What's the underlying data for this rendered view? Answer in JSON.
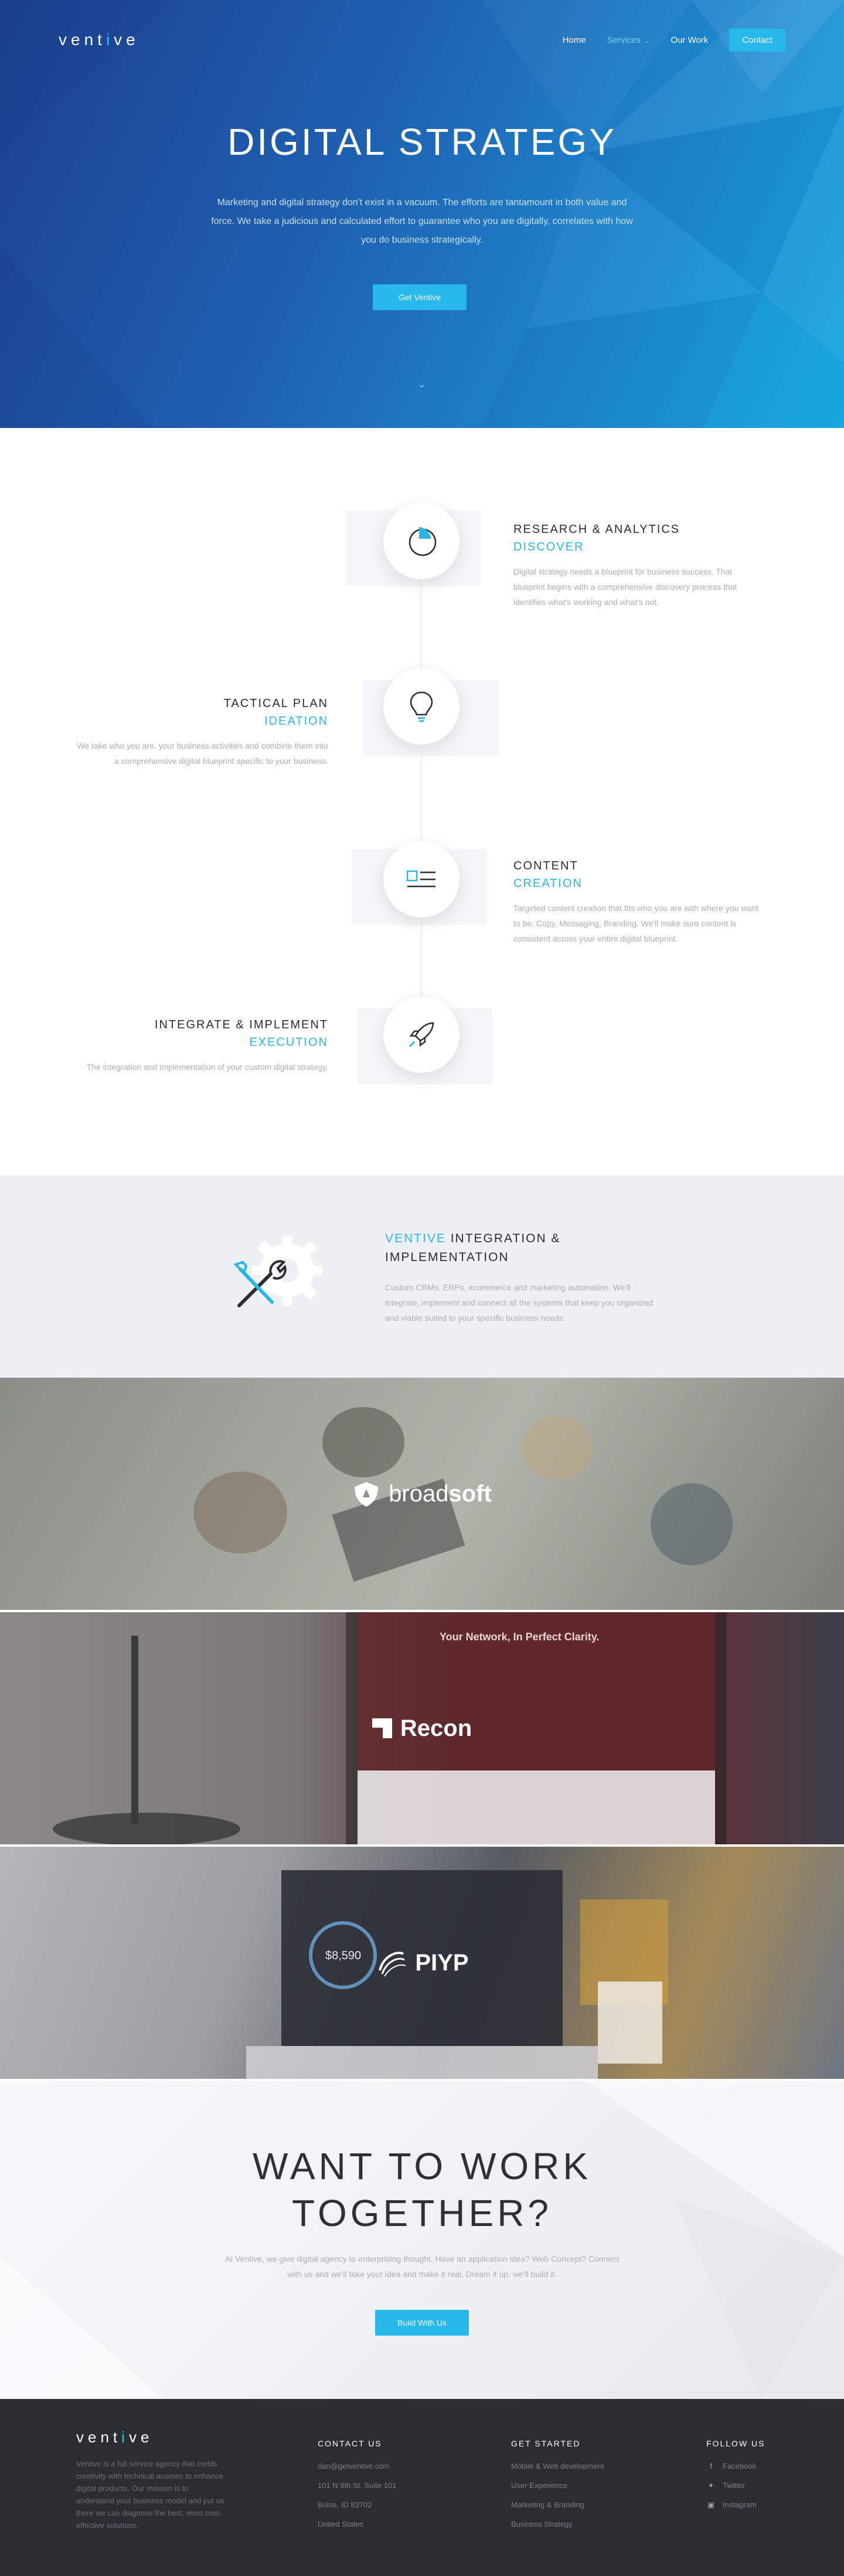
{
  "nav": {
    "logo": "ventive",
    "logo_pre": "vent",
    "logo_mark": "i",
    "logo_post": "ve",
    "items": [
      "Home",
      "Services",
      "Our Work",
      "Contact"
    ]
  },
  "hero": {
    "title": "DIGITAL STRATEGY",
    "text": "Marketing and digital strategy don't exist in a vacuum. The efforts are tantamount in both value and force. We take a judicious and calculated effort to guarantee who you are digitally, correlates with how you do business strategically.",
    "button": "Get Ventive"
  },
  "process": {
    "steps": [
      {
        "title": "RESEARCH & ANALYTICS",
        "sub": "DISCOVER",
        "desc": "Digital strategy needs a blueprint for business success. That blueprint begins with a comprehensive discovery process that identifies what's working and what's not.",
        "icon": "pie-chart-icon"
      },
      {
        "title": "TACTICAL PLAN",
        "sub": "IDEATION",
        "desc": "We take who you are, your business activities and combine them into a comprehensive digital blueprint specific to your business.",
        "icon": "lightbulb-icon"
      },
      {
        "title": "CONTENT",
        "sub": "CREATION",
        "desc": "Targeted content creation that fits who you are with where you want to be. Copy, Messaging, Branding. We'll make sure content is consistent across your entire digital blueprint.",
        "icon": "content-layout-icon"
      },
      {
        "title": "INTEGRATE & IMPLEMENT",
        "sub": "EXECUTION",
        "desc": "The integration and implementation of your custom digital strategy.",
        "icon": "rocket-icon"
      }
    ]
  },
  "integration": {
    "title_hl": "VENTIVE",
    "title_rest": "INTEGRATION & IMPLEMENTATION",
    "desc": "Custom CRMs, ERPs, ecommerce and marketing automation. We'll integrate, implement and connect all the systems that keep you organized and viable suited to your specific business needs."
  },
  "portfolio": [
    {
      "brand": "broadsoft",
      "brand_bold": "soft",
      "brand_light": "broad"
    },
    {
      "brand": "Recon"
    },
    {
      "brand": "PIYP"
    }
  ],
  "cta": {
    "title_line1": "WANT TO WORK",
    "title_line2": "TOGETHER?",
    "text": "At Ventive, we give digital agency to enterprising thought. Have an application idea? Web Concept? Connect with us and we'll take your idea and make it real. Dream it up, we'll build it.",
    "button": "Build With Us"
  },
  "footer": {
    "about": "Ventive is a full service agency that melds creativity with technical acumen to enhance digital products. Our mission is to understand your business model and put us there we can diagnose the best, most cost-effective solutions.",
    "contact": {
      "heading": "CONTACT US",
      "items": [
        "dan@getventive.com",
        "101 N 9th St. Suite 101",
        "Boise, ID 83702",
        "United States"
      ]
    },
    "started": {
      "heading": "GET STARTED",
      "items": [
        "Mobile & Web development",
        "User Experience",
        "Marketing & Branding",
        "Business Strategy"
      ]
    },
    "follow": {
      "heading": "FOLLOW US",
      "items": [
        {
          "label": "Facebook",
          "icon": "facebook-icon"
        },
        {
          "label": "Twitter",
          "icon": "twitter-icon"
        },
        {
          "label": "Instagram",
          "icon": "instagram-icon"
        }
      ]
    }
  },
  "colors": {
    "accent": "#27b8ec",
    "dark": "#2b2d33",
    "muted": "#a9aeb8"
  }
}
